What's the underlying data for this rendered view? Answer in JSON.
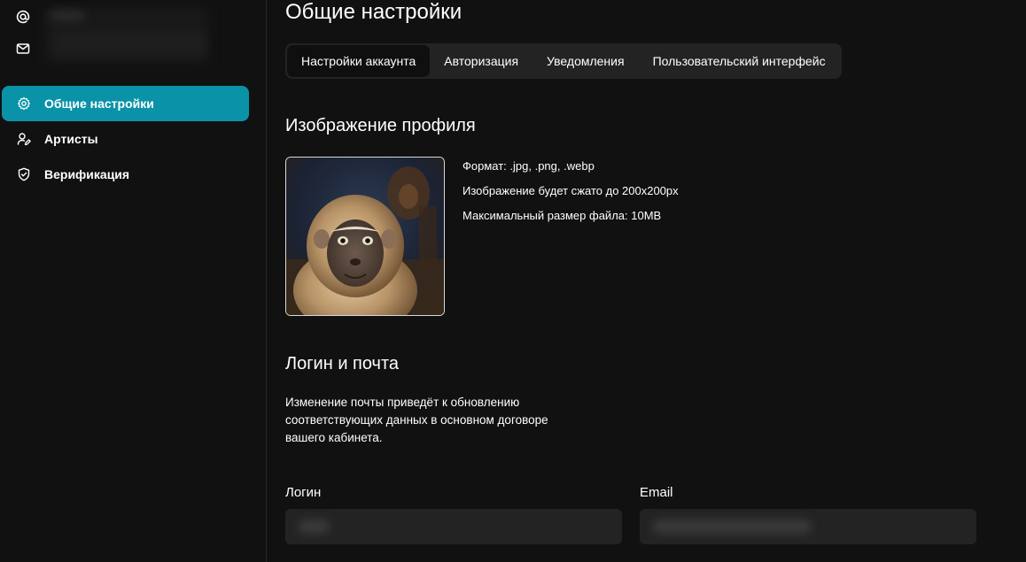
{
  "sidebar": {
    "contact_icons": [
      "at-sign-icon",
      "mail-icon"
    ],
    "nav_items": [
      {
        "label": "Общие настройки",
        "icon": "gear-icon",
        "active": true
      },
      {
        "label": "Артисты",
        "icon": "user-edit-icon",
        "active": false
      },
      {
        "label": "Верификация",
        "icon": "shield-check-icon",
        "active": false
      }
    ]
  },
  "main": {
    "title": "Общие настройки",
    "tabs": [
      {
        "label": "Настройки аккаунта",
        "active": true
      },
      {
        "label": "Авторизация",
        "active": false
      },
      {
        "label": "Уведомления",
        "active": false
      },
      {
        "label": "Пользовательский интерфейс",
        "active": false
      }
    ],
    "profile_image": {
      "title": "Изображение профиля",
      "format": "Формат: .jpg, .png, .webp",
      "compression": "Изображение будет сжато до 200x200px",
      "max_size": "Максимальный размер файла: 10MB"
    },
    "login_email": {
      "title": "Логин и почта",
      "description_lines": [
        "Изменение почты приведёт к обновлению",
        "соответствующих данных в основном договоре",
        "вашего кабинета."
      ],
      "login_label": "Логин",
      "email_label": "Email"
    }
  },
  "colors": {
    "background": "#111111",
    "accent": "#0a93a8",
    "tab_bar": "#232323",
    "input_bg": "#232323"
  }
}
